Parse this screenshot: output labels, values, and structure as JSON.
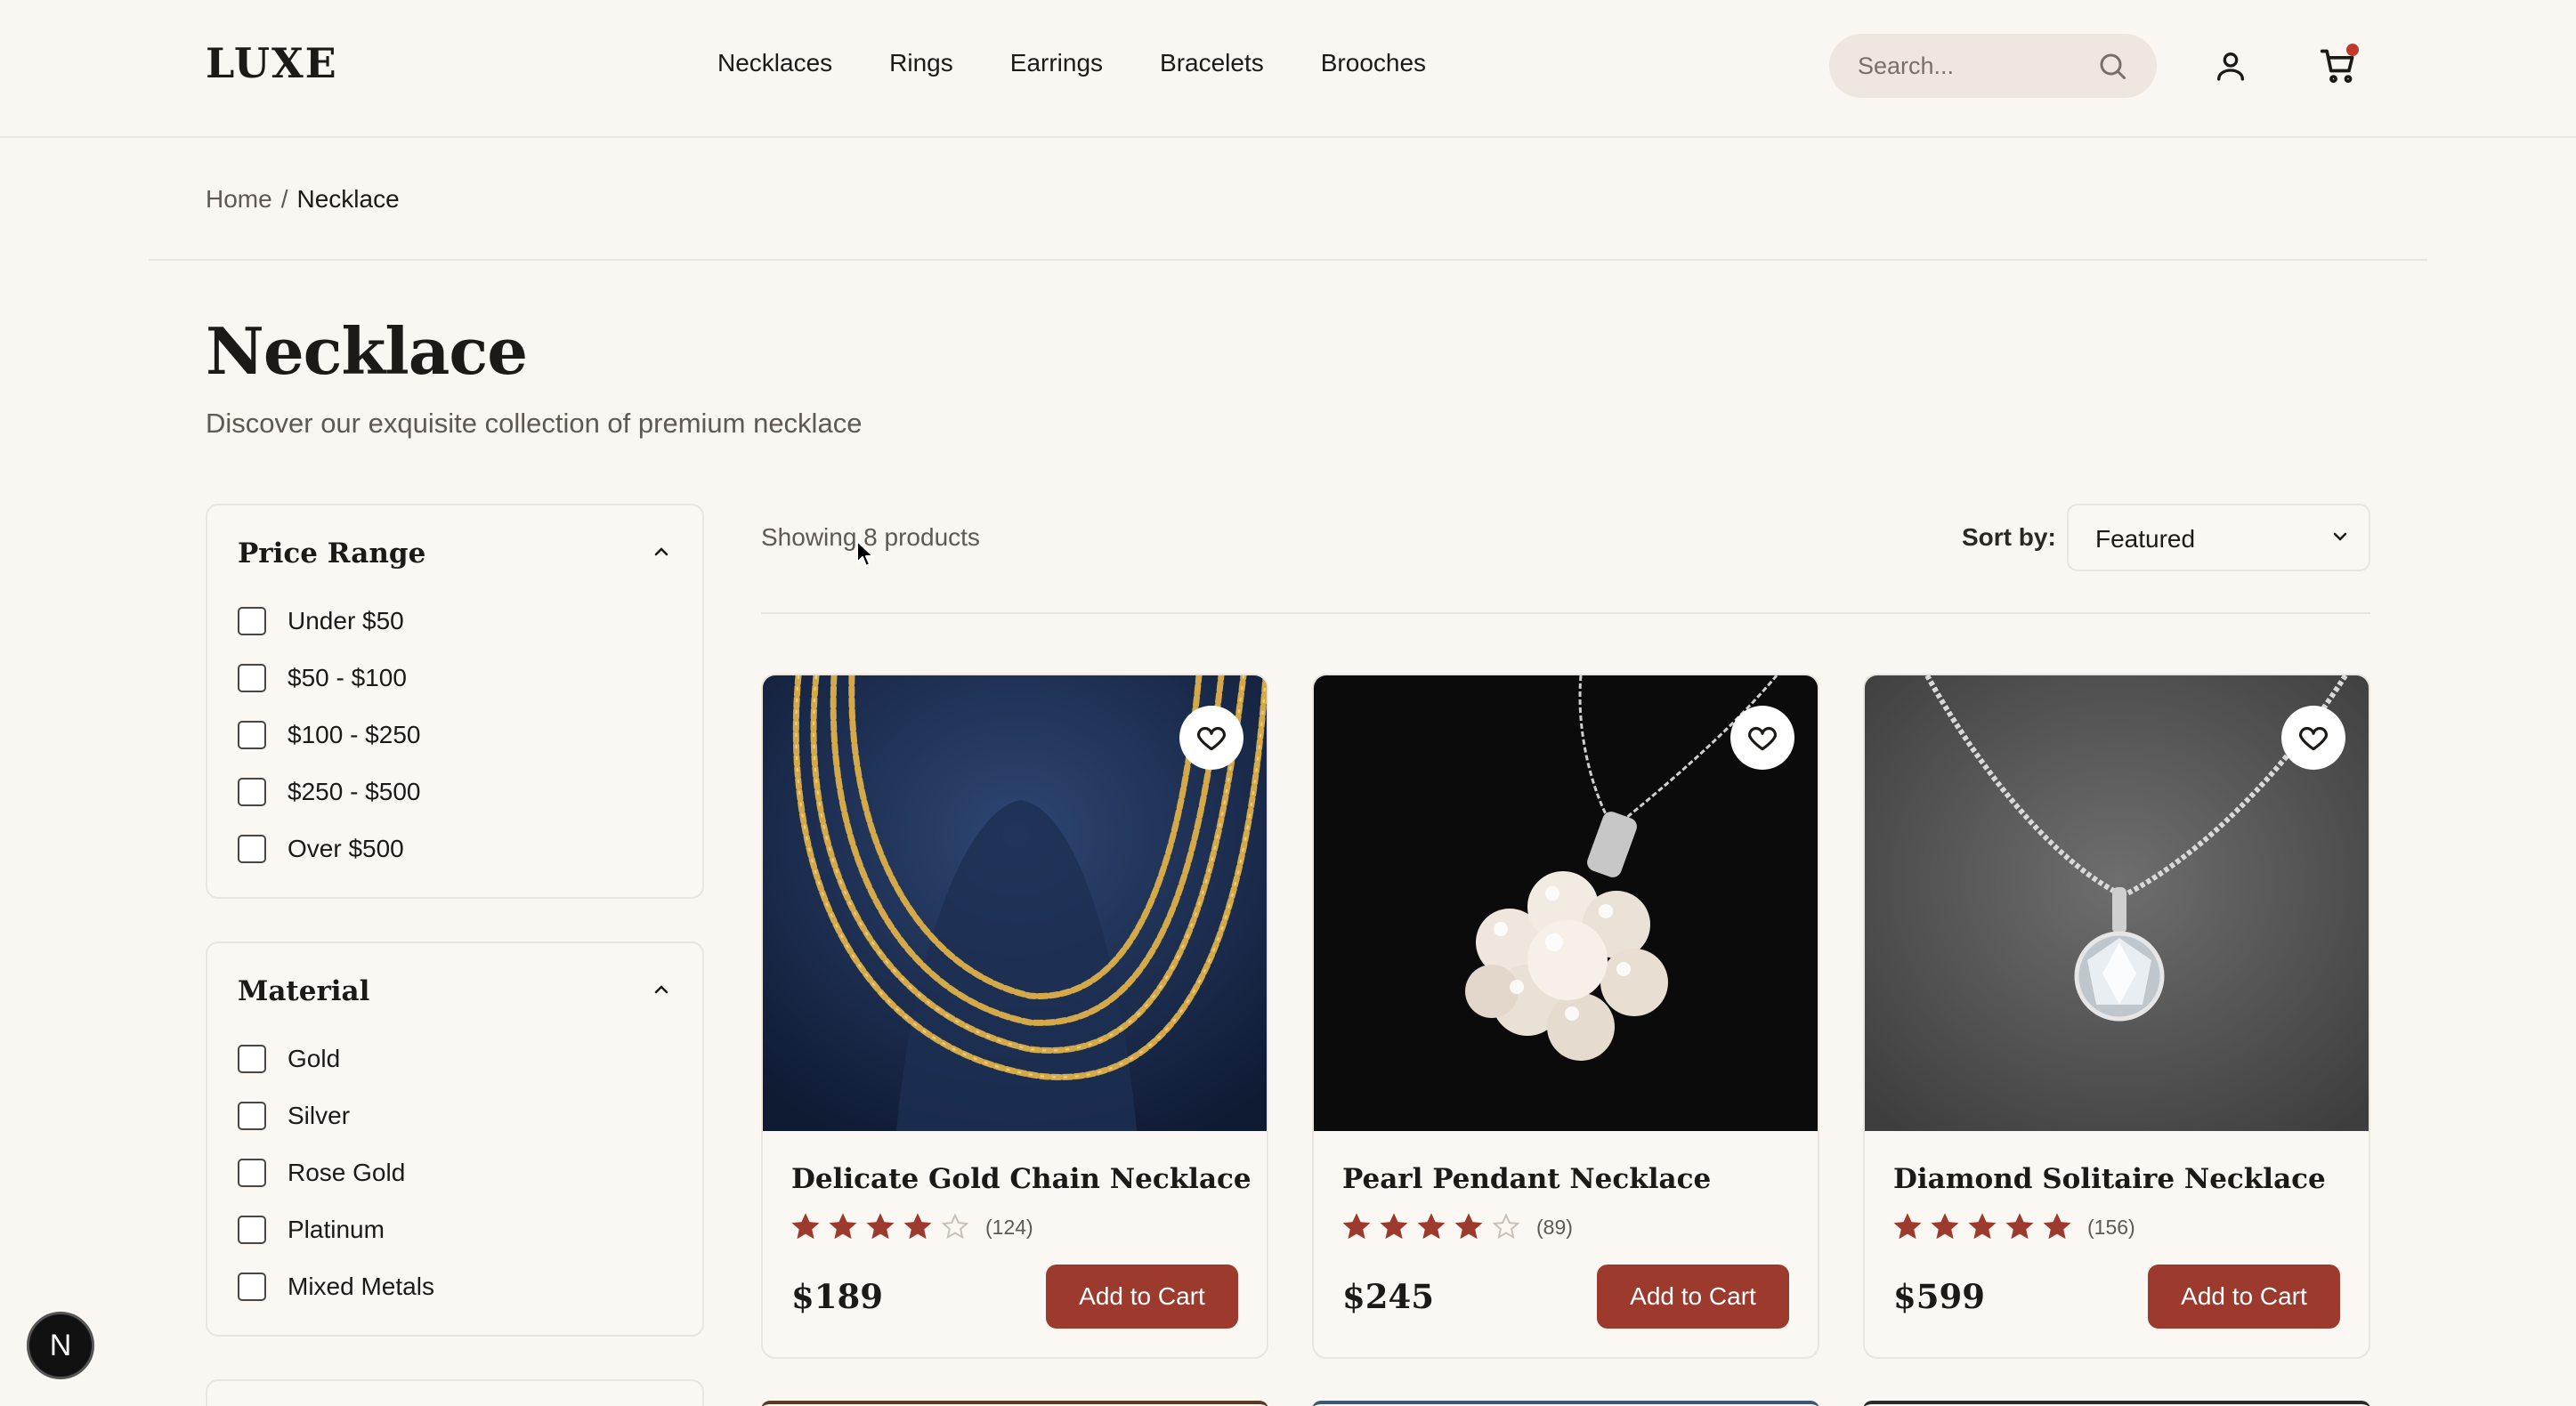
{
  "brand": "LUXE",
  "nav": [
    "Necklaces",
    "Rings",
    "Earrings",
    "Bracelets",
    "Brooches"
  ],
  "search": {
    "placeholder": "Search..."
  },
  "breadcrumb": {
    "home": "Home",
    "sep": "/",
    "current": "Necklace"
  },
  "page": {
    "title": "Necklace",
    "subtitle": "Discover our exquisite collection of premium necklace"
  },
  "filters": {
    "price": {
      "title": "Price Range",
      "options": [
        "Under $50",
        "$50 - $100",
        "$100 - $250",
        "$250 - $500",
        "Over $500"
      ]
    },
    "material": {
      "title": "Material",
      "options": [
        "Gold",
        "Silver",
        "Rose Gold",
        "Platinum",
        "Mixed Metals"
      ]
    }
  },
  "toolbar": {
    "showing": "Showing 8 products",
    "sort_label": "Sort by:",
    "sort_value": "Featured"
  },
  "products": [
    {
      "name": "Delicate Gold Chain Necklace",
      "rating": 4,
      "reviews": "(124)",
      "price": "$189",
      "cta": "Add to Cart"
    },
    {
      "name": "Pearl Pendant Necklace",
      "rating": 4,
      "reviews": "(89)",
      "price": "$245",
      "cta": "Add to Cart"
    },
    {
      "name": "Diamond Solitaire Necklace",
      "rating": 5,
      "reviews": "(156)",
      "price": "$599",
      "cta": "Add to Cart"
    }
  ],
  "dev_badge": "N",
  "colors": {
    "accent": "#9c3a2e",
    "background": "#faf6f1",
    "star": "#9c3a2e",
    "cart_dot": "#c0392b"
  },
  "icons": [
    "search-icon",
    "user-icon",
    "cart-icon",
    "chevron-up-icon",
    "chevron-down-icon",
    "heart-icon",
    "star-icon"
  ]
}
